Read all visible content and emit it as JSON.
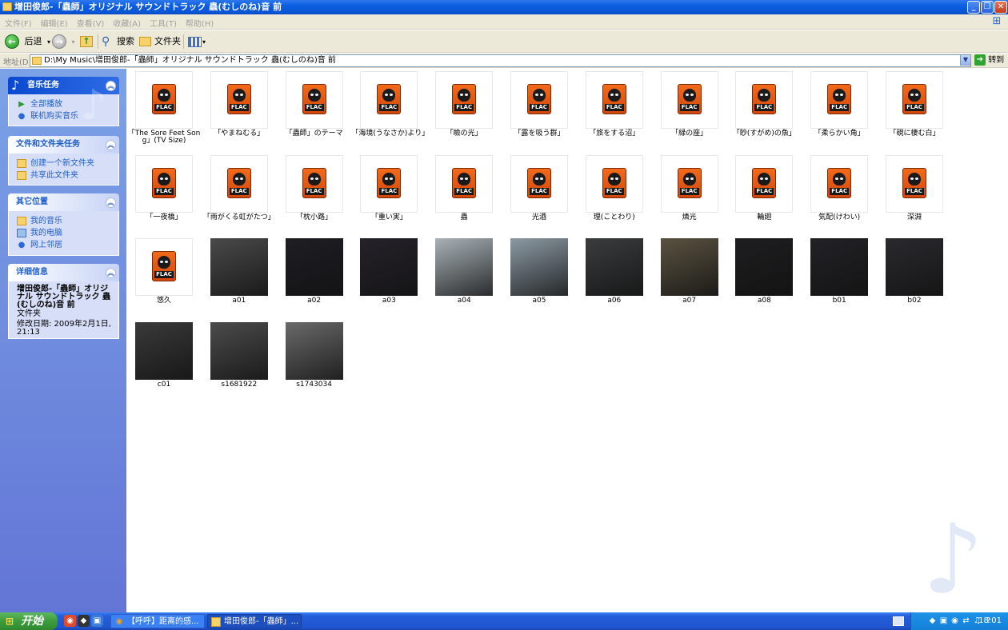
{
  "window": {
    "title": "增田俊郎-「蟲師」オリジナル サウンドトラック  蟲(むしのね)音 前"
  },
  "menu": [
    "文件(F)",
    "编辑(E)",
    "查看(V)",
    "收藏(A)",
    "工具(T)",
    "帮助(H)"
  ],
  "toolbar": {
    "back_label": "后退",
    "search_label": "搜索",
    "folders_label": "文件夹"
  },
  "address": {
    "label": "地址(D)",
    "value": "D:\\My Music\\增田俊郎-「蟲師」オリジナル サウンドトラック  蟲(むしのね)音 前",
    "go_label": "转到"
  },
  "sidebar": {
    "music_tasks": {
      "title": "音乐任务",
      "items": [
        {
          "label": "全部播放",
          "icon": "play-icon"
        },
        {
          "label": "联机购买音乐",
          "icon": "globe-icon"
        }
      ]
    },
    "file_tasks": {
      "title": "文件和文件夹任务",
      "items": [
        {
          "label": "创建一个新文件夹",
          "icon": "new-folder-icon"
        },
        {
          "label": "共享此文件夹",
          "icon": "share-folder-icon"
        }
      ]
    },
    "other_places": {
      "title": "其它位置",
      "items": [
        {
          "label": "我的音乐",
          "icon": "music-folder-icon"
        },
        {
          "label": "我的电脑",
          "icon": "computer-icon"
        },
        {
          "label": "网上邻居",
          "icon": "network-icon"
        }
      ]
    },
    "details": {
      "title": "详细信息",
      "name": "增田俊郎-「蟲師」オリジナル サウンドトラック 蟲(むしのね)音 前",
      "type": "文件夹",
      "modified": "修改日期: 2009年2月1日, 21:13"
    }
  },
  "files": [
    {
      "name": "「The Sore Feet Song」(TV Size)",
      "kind": "flac"
    },
    {
      "name": "「やまねむる」",
      "kind": "flac"
    },
    {
      "name": "「蟲師」のテーマ",
      "kind": "flac"
    },
    {
      "name": "「海境(うなさか)より」",
      "kind": "flac"
    },
    {
      "name": "「瞼の光」",
      "kind": "flac"
    },
    {
      "name": "「露を吸う群」",
      "kind": "flac"
    },
    {
      "name": "「旅をする沼」",
      "kind": "flac"
    },
    {
      "name": "「緑の座」",
      "kind": "flac"
    },
    {
      "name": "「眇(すがめ)の魚」",
      "kind": "flac"
    },
    {
      "name": "「柔らかい角」",
      "kind": "flac"
    },
    {
      "name": "「硯に棲む白」",
      "kind": "flac"
    },
    {
      "name": "「一夜橋」",
      "kind": "flac"
    },
    {
      "name": "「雨がくる虹がたつ」",
      "kind": "flac"
    },
    {
      "name": "「枕小路」",
      "kind": "flac"
    },
    {
      "name": "「重い実」",
      "kind": "flac"
    },
    {
      "name": "蟲",
      "kind": "flac"
    },
    {
      "name": "光酒",
      "kind": "flac"
    },
    {
      "name": "理(ことわり)",
      "kind": "flac"
    },
    {
      "name": "燐光",
      "kind": "flac"
    },
    {
      "name": "輪廻",
      "kind": "flac"
    },
    {
      "name": "気配(けわい)",
      "kind": "flac"
    },
    {
      "name": "深淵",
      "kind": "flac"
    },
    {
      "name": "悠久",
      "kind": "flac"
    },
    {
      "name": "a01",
      "kind": "image",
      "fill": "#4a4a4a"
    },
    {
      "name": "a02",
      "kind": "image",
      "fill": "#1e1e24"
    },
    {
      "name": "a03",
      "kind": "image",
      "fill": "#25222a"
    },
    {
      "name": "a04",
      "kind": "image",
      "fill": "#a9b2b8"
    },
    {
      "name": "a05",
      "kind": "image",
      "fill": "#8c9aa4"
    },
    {
      "name": "a06",
      "kind": "image",
      "fill": "#3a3c3e"
    },
    {
      "name": "a07",
      "kind": "image",
      "fill": "#5a5240"
    },
    {
      "name": "a08",
      "kind": "image",
      "fill": "#1e1e20"
    },
    {
      "name": "b01",
      "kind": "image",
      "fill": "#222226"
    },
    {
      "name": "b02",
      "kind": "image",
      "fill": "#2a2a2e"
    },
    {
      "name": "c01",
      "kind": "image",
      "fill": "#3a3a3a"
    },
    {
      "name": "s1681922",
      "kind": "image",
      "fill": "#4c4c4c"
    },
    {
      "name": "s1743034",
      "kind": "image",
      "fill": "#6a6a6a"
    }
  ],
  "taskbar": {
    "start_label": "开始",
    "tasks": [
      {
        "label": "【呼呼】距离的感...",
        "icon": "browser-icon"
      },
      {
        "label": "增田俊郎-「蟲師」...",
        "icon": "folder-icon"
      }
    ],
    "clock": "18:01"
  }
}
